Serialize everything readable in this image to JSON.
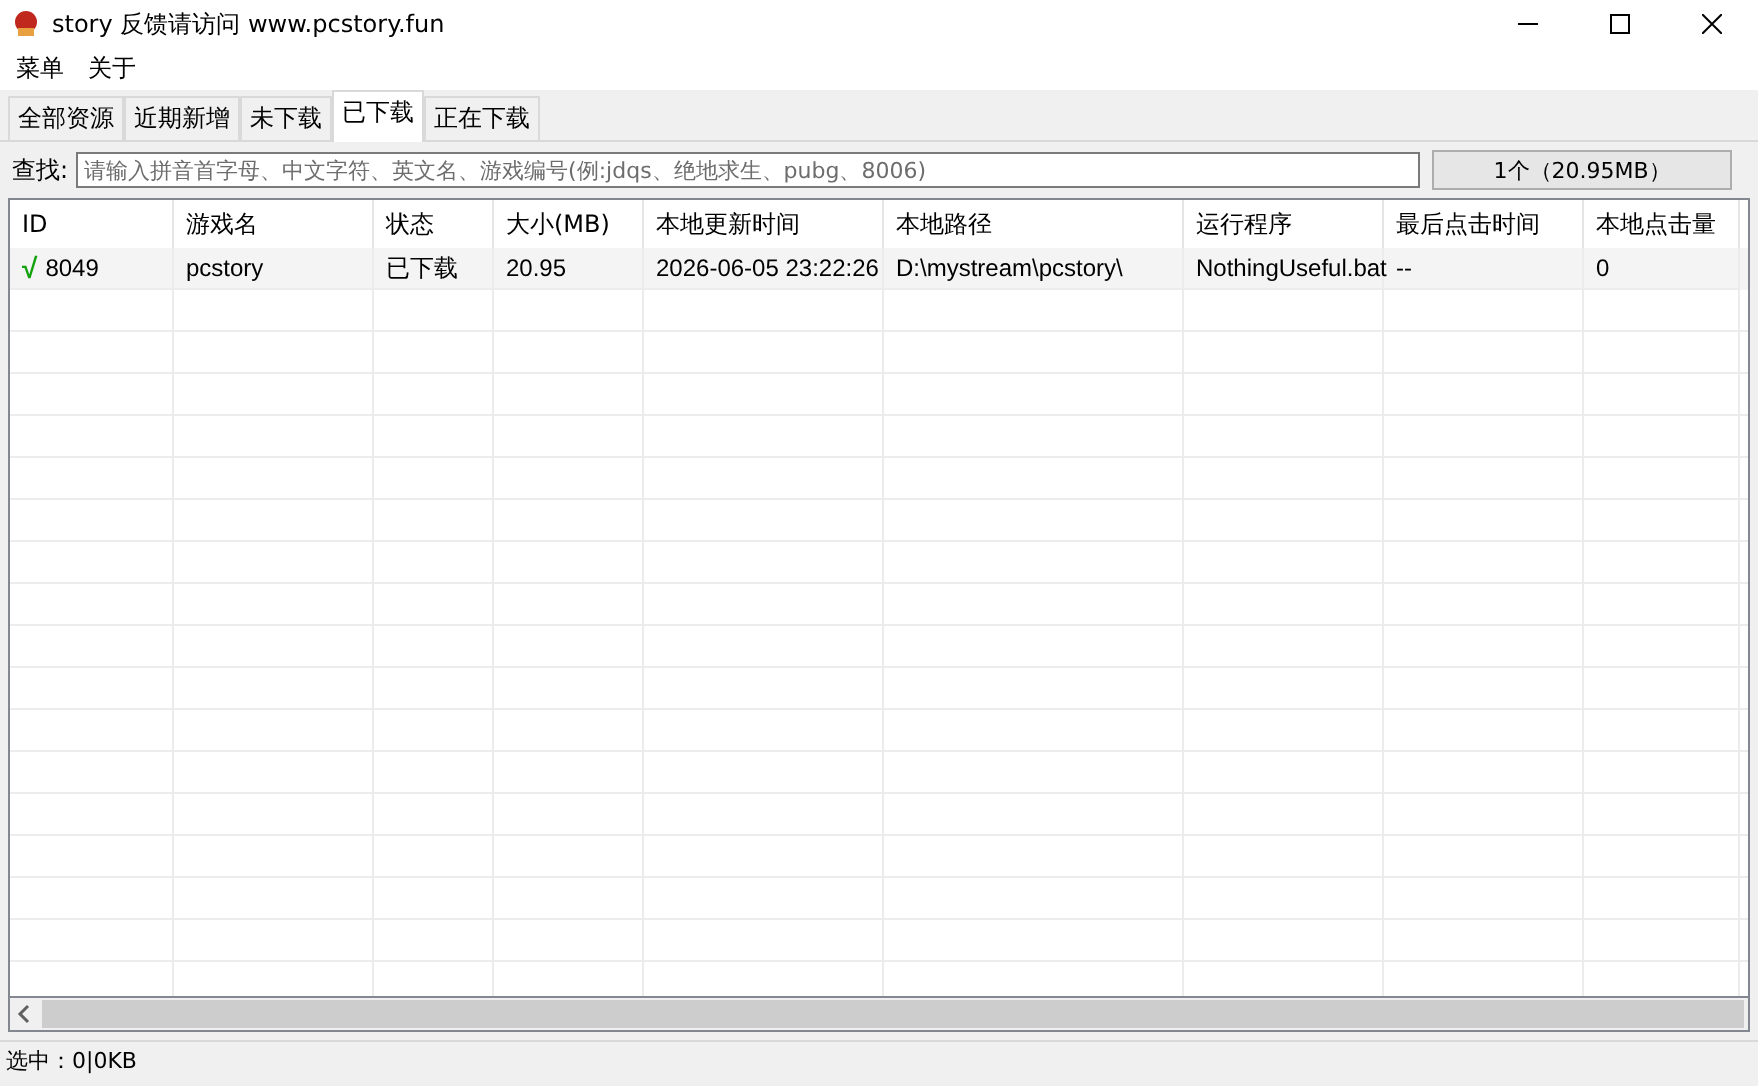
{
  "window": {
    "title": "story 反馈请访问 www.pcstory.fun"
  },
  "menu": [
    "菜单",
    "关于"
  ],
  "tabs": [
    {
      "label": "全部资源",
      "selected": false
    },
    {
      "label": "近期新增",
      "selected": false
    },
    {
      "label": "未下载",
      "selected": false
    },
    {
      "label": "已下载",
      "selected": true
    },
    {
      "label": "正在下载",
      "selected": false
    }
  ],
  "search": {
    "label": "查找:",
    "placeholder": "请输入拼音首字母、中文字符、英文名、游戏编号(例:jdqs、绝地求生、pubg、8006)",
    "summary": "1个（20.95MB）"
  },
  "table": {
    "columns": [
      "ID",
      "游戏名",
      "状态",
      "大小(MB)",
      "本地更新时间",
      "本地路径",
      "运行程序",
      "最后点击时间",
      "本地点击量"
    ],
    "rows": [
      {
        "mark": "√",
        "cells": [
          "8049",
          "pcstory",
          "已下载",
          "20.95",
          "2026-06-05 23:22:26",
          "D:\\mystream\\pcstory\\",
          "NothingUseful.bat",
          "--",
          "0"
        ]
      }
    ]
  },
  "status_bar": "选中：0|0KB"
}
